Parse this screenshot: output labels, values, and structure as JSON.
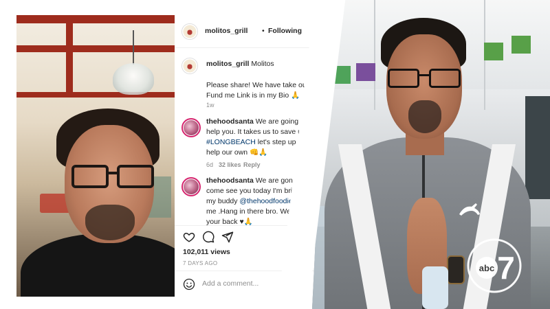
{
  "instagram": {
    "header": {
      "username": "molitos_grill",
      "separator": "•",
      "follow_status": "Following"
    },
    "caption": {
      "username": "molitos_grill",
      "title": "Molitos",
      "lines": [
        "Please share! We have take out! G",
        "Fund me Link is in my Bio 🙏"
      ],
      "time": "1w"
    },
    "comments": [
      {
        "username": "thehoodsanta",
        "lines": [
          {
            "pre": "We are going to",
            "link": "",
            "post": ""
          },
          {
            "pre": "help you. It takes us to save us.",
            "link": "",
            "post": ""
          },
          {
            "pre": "",
            "link": "#LONGBEACH",
            "post": " let's step up anc"
          },
          {
            "pre": "help our own 👊🙏",
            "link": "",
            "post": ""
          }
        ],
        "time": "6d",
        "likes": "32 likes",
        "reply": "Reply"
      },
      {
        "username": "thehoodsanta",
        "lines": [
          {
            "pre": "We are gonna",
            "link": "",
            "post": ""
          },
          {
            "pre": "come see you today I'm brin",
            "link": "",
            "post": ""
          },
          {
            "pre": "my buddy ",
            "link": "@thehoodfoodie",
            "post": ""
          },
          {
            "pre": "me .Hang in there bro. We",
            "link": "",
            "post": ""
          },
          {
            "pre": "your back ♥🙏",
            "link": "",
            "post": ""
          }
        ]
      }
    ],
    "views": "102,011 views",
    "posted": "7 DAYS AGO",
    "add_comment_placeholder": "Add a comment..."
  },
  "channel_logo": {
    "text": "abc",
    "number": "7"
  },
  "colors": {
    "ig_text": "#262626",
    "ig_muted": "#8e8e8e",
    "ig_link": "#00376b",
    "story_ring": "#d6246e",
    "beam_red": "#9e2c1d"
  }
}
